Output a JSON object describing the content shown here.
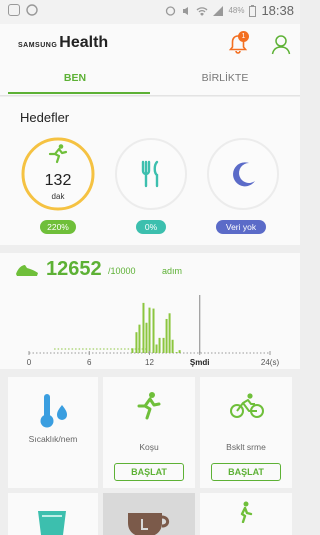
{
  "status_bar": {
    "time": "18:38",
    "battery": "48%"
  },
  "header": {
    "brand_small": "SAMSUNG",
    "brand_large": "Health",
    "notification_count": "1"
  },
  "tabs": [
    {
      "label": "BEN",
      "active": true
    },
    {
      "label": "BİRLİKTE",
      "active": false
    }
  ],
  "goals": {
    "title": "Hedefler",
    "items": [
      {
        "icon": "running-icon",
        "value": "132",
        "unit": "dak",
        "badge": "220%",
        "color": "#6fbf3a",
        "progress": 1.0
      },
      {
        "icon": "fork-knife-icon",
        "badge": "0%",
        "color": "#3cbfae",
        "progress": 0
      },
      {
        "icon": "moon-icon",
        "badge": "Veri yok",
        "color": "#5b6bc8",
        "progress": 0
      }
    ]
  },
  "steps": {
    "count": "12652",
    "goal": "/10000",
    "unit": "adım"
  },
  "chart_data": {
    "type": "bar",
    "x": [
      10.3,
      10.7,
      11.0,
      11.4,
      11.7,
      12.0,
      12.4,
      12.7,
      13.0,
      13.4,
      13.7,
      14.0,
      14.3,
      14.7,
      15.0
    ],
    "values": [
      5,
      22,
      30,
      53,
      32,
      48,
      47,
      9,
      16,
      16,
      36,
      42,
      14,
      1,
      3
    ],
    "xlim": [
      0,
      24
    ],
    "xticks": [
      "0",
      "6",
      "12",
      "Şmdi",
      "24(s)"
    ],
    "xtick_pos": [
      0,
      6,
      12,
      17,
      24
    ],
    "now": 17,
    "color": "#8cc63f"
  },
  "cards": {
    "row1": [
      {
        "icon": "thermometer-drop-icon",
        "label": "Sıcaklık/nem",
        "button": ""
      },
      {
        "icon": "runner-icon",
        "label": "Koşu",
        "button": "BAŞLAT"
      },
      {
        "icon": "cyclist-icon",
        "label": "Bsklt srme",
        "button": "BAŞLAT"
      }
    ]
  }
}
